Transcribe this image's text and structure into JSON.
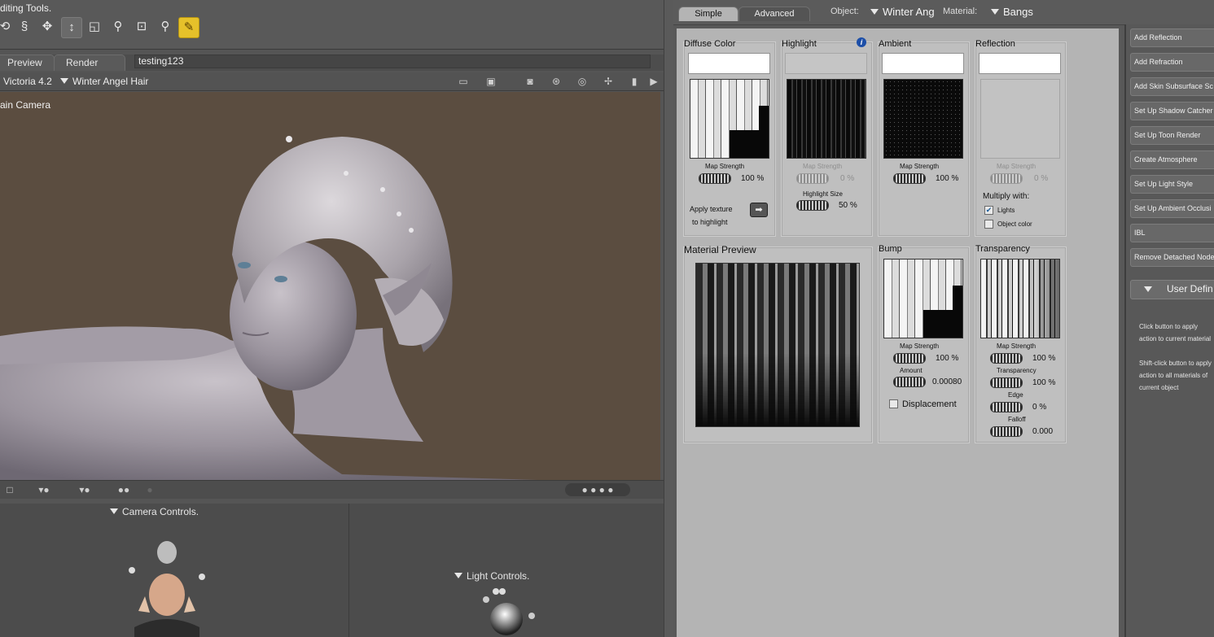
{
  "left": {
    "editing_tools_title": "diting Tools.",
    "tools": [
      "rotate-icon",
      "twist-icon",
      "move-icon",
      "translate-icon",
      "scale-icon",
      "taper-icon",
      "chain-icon",
      "zoom-icon",
      "color-pen-icon"
    ],
    "tabs": [
      "Preview",
      "Render"
    ],
    "render_name": "testing123",
    "figure": "Victoria 4.2",
    "actor": "Winter Angel Hair",
    "camera_label": "ain Camera",
    "camera_controls": "Camera Controls.",
    "light_controls": "Light Controls."
  },
  "material": {
    "tabs": [
      "Simple",
      "Advanced"
    ],
    "object_label": "Object:",
    "object_value": "Winter Ang",
    "material_label": "Material:",
    "material_value": "Bangs",
    "diffuse": {
      "title": "Diffuse Color",
      "map_strength": "Map Strength",
      "value": "100 %",
      "apply1": "Apply texture",
      "apply2": "to highlight"
    },
    "highlight": {
      "title": "Highlight",
      "map_strength": "Map Strength",
      "value": "0 %",
      "size_label": "Highlight Size",
      "size_value": "50 %"
    },
    "ambient": {
      "title": "Ambient",
      "map_strength": "Map Strength",
      "value": "100 %"
    },
    "reflection": {
      "title": "Reflection",
      "map_strength": "Map Strength",
      "value": "0 %",
      "multiply": "Multiply with:",
      "lights": "Lights",
      "object_color": "Object color"
    },
    "preview": {
      "title": "Material Preview"
    },
    "bump": {
      "title": "Bump",
      "map_strength": "Map Strength",
      "value": "100 %",
      "amount": "Amount",
      "amount_value": "0.00080",
      "displacement": "Displacement"
    },
    "transparency": {
      "title": "Transparency",
      "map_strength": "Map Strength",
      "value": "100 %",
      "transp_label": "Transparency",
      "transp_value": "100 %",
      "edge": "Edge",
      "edge_value": "0 %",
      "falloff": "Falloff",
      "falloff_value": "0.000"
    }
  },
  "sidebar": {
    "buttons": [
      "Add Reflection",
      "Add Refraction",
      "Add Skin Subsurface Sc",
      "Set Up Shadow Catcher",
      "Set Up Toon Render",
      "Create Atmosphere",
      "Set Up Light Style",
      "Set Up Ambient Occlusi",
      "IBL",
      "Remove Detached Node"
    ],
    "user_defined": "User Defin",
    "help1": "Click button to apply action to current material",
    "help2": "Shift-click button to apply action to all materials of current object"
  }
}
